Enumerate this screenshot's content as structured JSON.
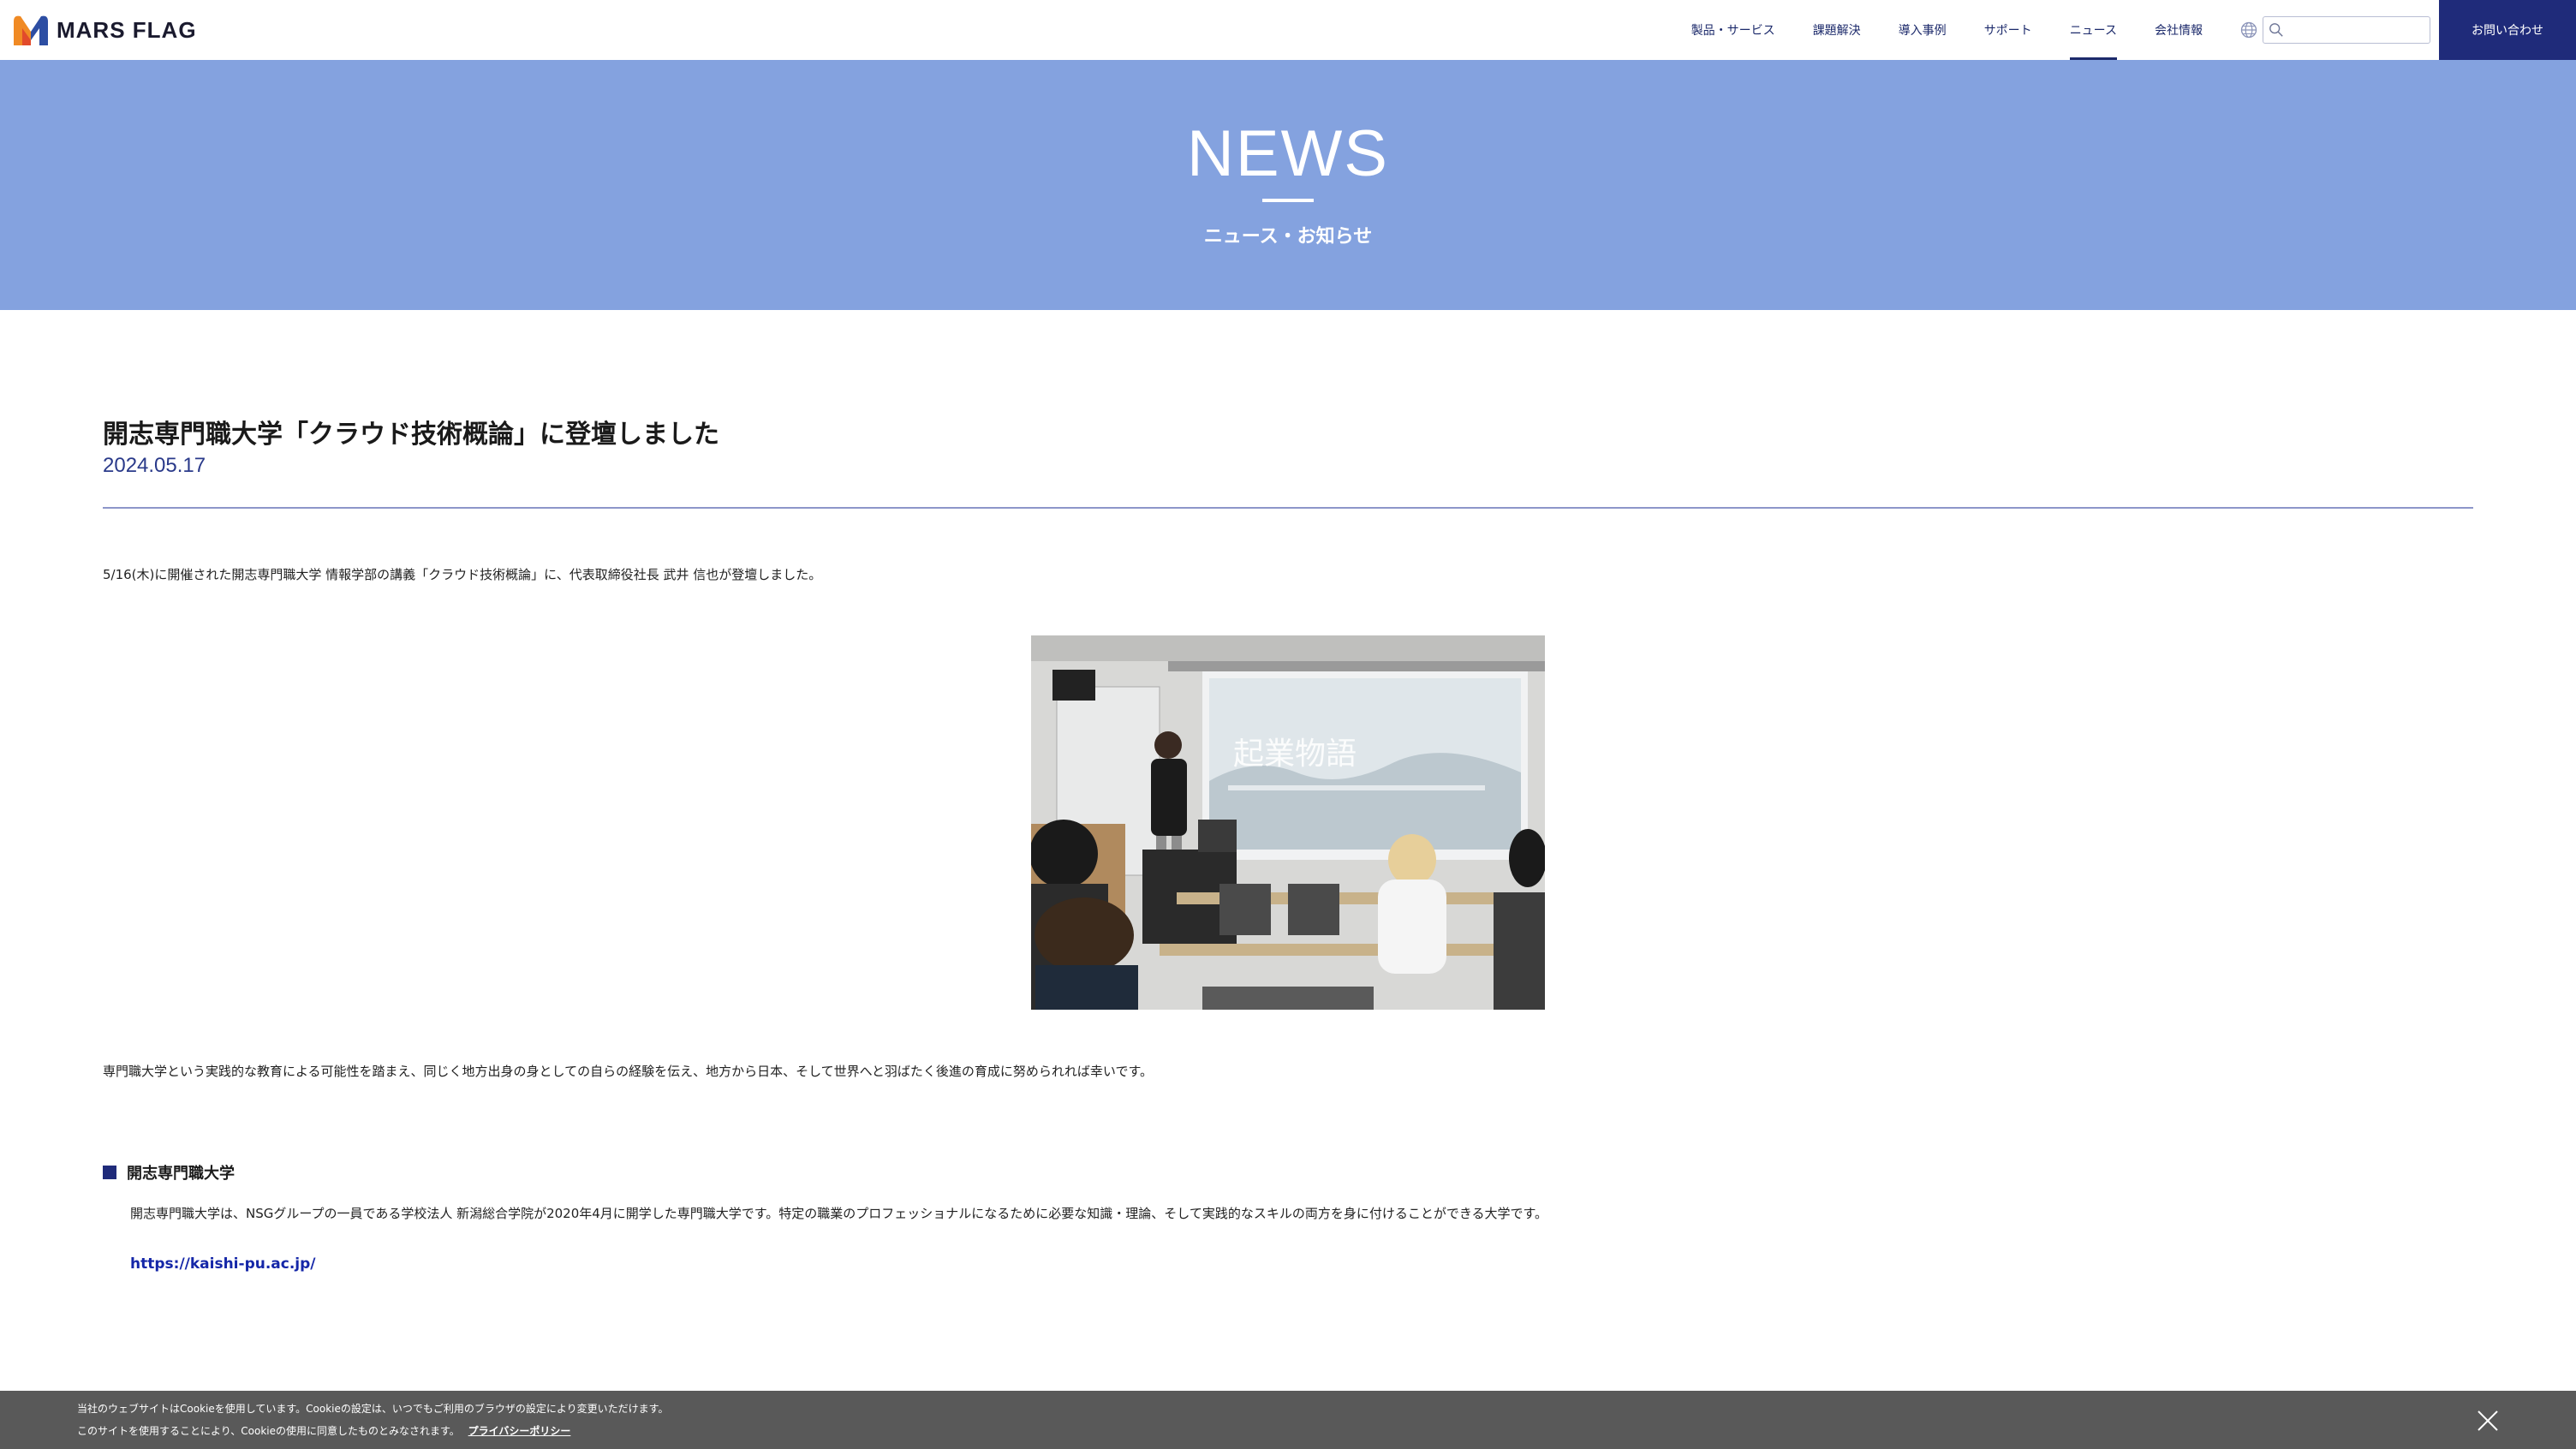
{
  "brand": {
    "name": "MARS FLAG",
    "colors": {
      "navy": "#1f2b7a",
      "hero": "#84a2df",
      "logo_orange": "#f08a24",
      "logo_blue": "#2d4ea3"
    }
  },
  "nav": {
    "items": [
      {
        "label": "製品・サービス",
        "active": false
      },
      {
        "label": "課題解決",
        "active": false
      },
      {
        "label": "導入事例",
        "active": false
      },
      {
        "label": "サポート",
        "active": false
      },
      {
        "label": "ニュース",
        "active": true
      },
      {
        "label": "会社情報",
        "active": false
      }
    ],
    "search_placeholder": "",
    "contact_label": "お問い合わせ",
    "icons": [
      "globe-icon",
      "search-icon"
    ]
  },
  "hero": {
    "title": "NEWS",
    "subtitle": "ニュース・お知らせ"
  },
  "article": {
    "title": "開志専門職大学「クラウド技術概論」に登壇しました",
    "date": "2024.05.17",
    "lead": "5/16(木)に開催された開志専門職大学 情報学部の講義「クラウド技術概論」に、代表取締役社長 武井 信也が登壇しました。",
    "photo_screen_text": "起業物語",
    "body": "専門職大学という実践的な教育による可能性を踏まえ、同じく地方出身の身としての自らの経験を伝え、地方から日本、そして世界へと羽ばたく後進の育成に努められれば幸いです。",
    "section_title": "開志専門職大学",
    "section_desc": "開志専門職大学は、NSGグループの一員である学校法人 新潟総合学院が2020年4月に開学した専門職大学です。特定の職業のプロフェッショナルになるために必要な知識・理論、そして実践的なスキルの両方を身に付けることができる大学です。",
    "link": "https://kaishi-pu.ac.jp/"
  },
  "cookie": {
    "line1": "当社のウェブサイトはCookieを使用しています。Cookieの設定は、いつでもご利用のブラウザの設定により変更いただけます。",
    "line2": "このサイトを使用することにより、Cookieの使用に同意したものとみなされます。",
    "policy_link": "プライバシーポリシー"
  }
}
